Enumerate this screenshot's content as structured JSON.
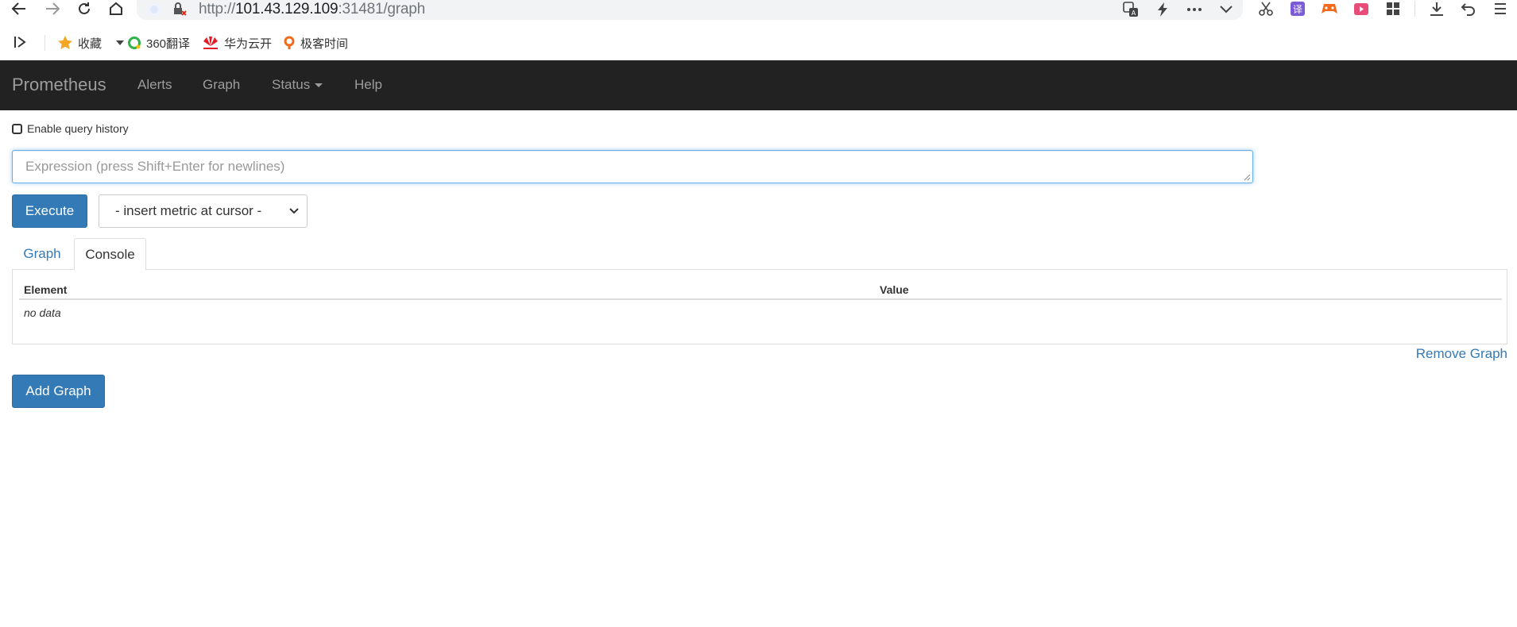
{
  "browser": {
    "url_scheme": "http://",
    "url_host": "101.43.129.109",
    "url_rest": ":31481/graph",
    "bookmarks": [
      {
        "label": "收藏",
        "icon": "star-icon"
      },
      {
        "label": "360翻译",
        "icon": "360-icon"
      },
      {
        "label": "华为云开",
        "icon": "huawei-icon"
      },
      {
        "label": "极客时间",
        "icon": "geektime-icon"
      }
    ]
  },
  "navbar": {
    "brand": "Prometheus",
    "links": [
      "Alerts",
      "Graph",
      "Status",
      "Help"
    ]
  },
  "query": {
    "history_label": "Enable query history",
    "history_checked": false,
    "expression_placeholder": "Expression (press Shift+Enter for newlines)",
    "execute_label": "Execute",
    "metric_select_value": "- insert metric at cursor -"
  },
  "tabs": [
    {
      "label": "Graph",
      "active": false
    },
    {
      "label": "Console",
      "active": true
    }
  ],
  "console_table": {
    "headers": [
      "Element",
      "Value"
    ],
    "empty_text": "no data"
  },
  "actions": {
    "remove_graph": "Remove Graph",
    "add_graph": "Add Graph"
  },
  "colors": {
    "navbar_bg": "#222222",
    "primary": "#337ab7",
    "link": "#337ab7"
  }
}
